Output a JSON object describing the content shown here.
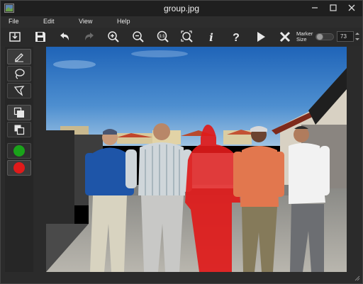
{
  "window": {
    "title": "group.jpg",
    "app_icon": "app-icon",
    "controls": [
      "minimize-icon",
      "maximize-icon",
      "close-icon"
    ]
  },
  "menu": {
    "items": [
      {
        "label": "File"
      },
      {
        "label": "Edit"
      },
      {
        "label": "View"
      },
      {
        "label": "Help"
      }
    ]
  },
  "toolbar": {
    "buttons": [
      {
        "name": "import",
        "icon": "import-icon"
      },
      {
        "name": "save",
        "icon": "save-icon"
      },
      {
        "name": "undo",
        "icon": "undo-icon"
      },
      {
        "name": "redo",
        "icon": "redo-icon",
        "enabled": false
      },
      {
        "name": "zoom-in",
        "icon": "zoom-in-icon"
      },
      {
        "name": "zoom-out",
        "icon": "zoom-out-icon"
      },
      {
        "name": "actual-size",
        "icon": "zoom-1-1-icon",
        "text": "1:1"
      },
      {
        "name": "fit",
        "icon": "zoom-fit-icon"
      },
      {
        "name": "info",
        "icon": "info-icon",
        "text": "i"
      },
      {
        "name": "help",
        "icon": "help-icon",
        "text": "?"
      },
      {
        "name": "run",
        "icon": "play-icon"
      },
      {
        "name": "clear",
        "icon": "clear-icon"
      }
    ],
    "marker_size": {
      "label_line1": "Marker",
      "label_line2": "Size",
      "value": "73"
    }
  },
  "side_tools": {
    "items": [
      {
        "name": "pencil",
        "icon": "pencil-icon",
        "active": true
      },
      {
        "name": "lasso",
        "icon": "lasso-icon"
      },
      {
        "name": "polygon",
        "icon": "polygon-lasso-icon"
      },
      {
        "name": "mask-front",
        "icon": "layer-front-icon",
        "active": true
      },
      {
        "name": "mask-back",
        "icon": "layer-back-icon"
      },
      {
        "name": "foreground-color",
        "color": "#1aa31a"
      },
      {
        "name": "background-color",
        "color": "#e01a1a",
        "active": true
      }
    ]
  },
  "image": {
    "filename": "group.jpg",
    "highlight_color": "#e01a1a"
  }
}
